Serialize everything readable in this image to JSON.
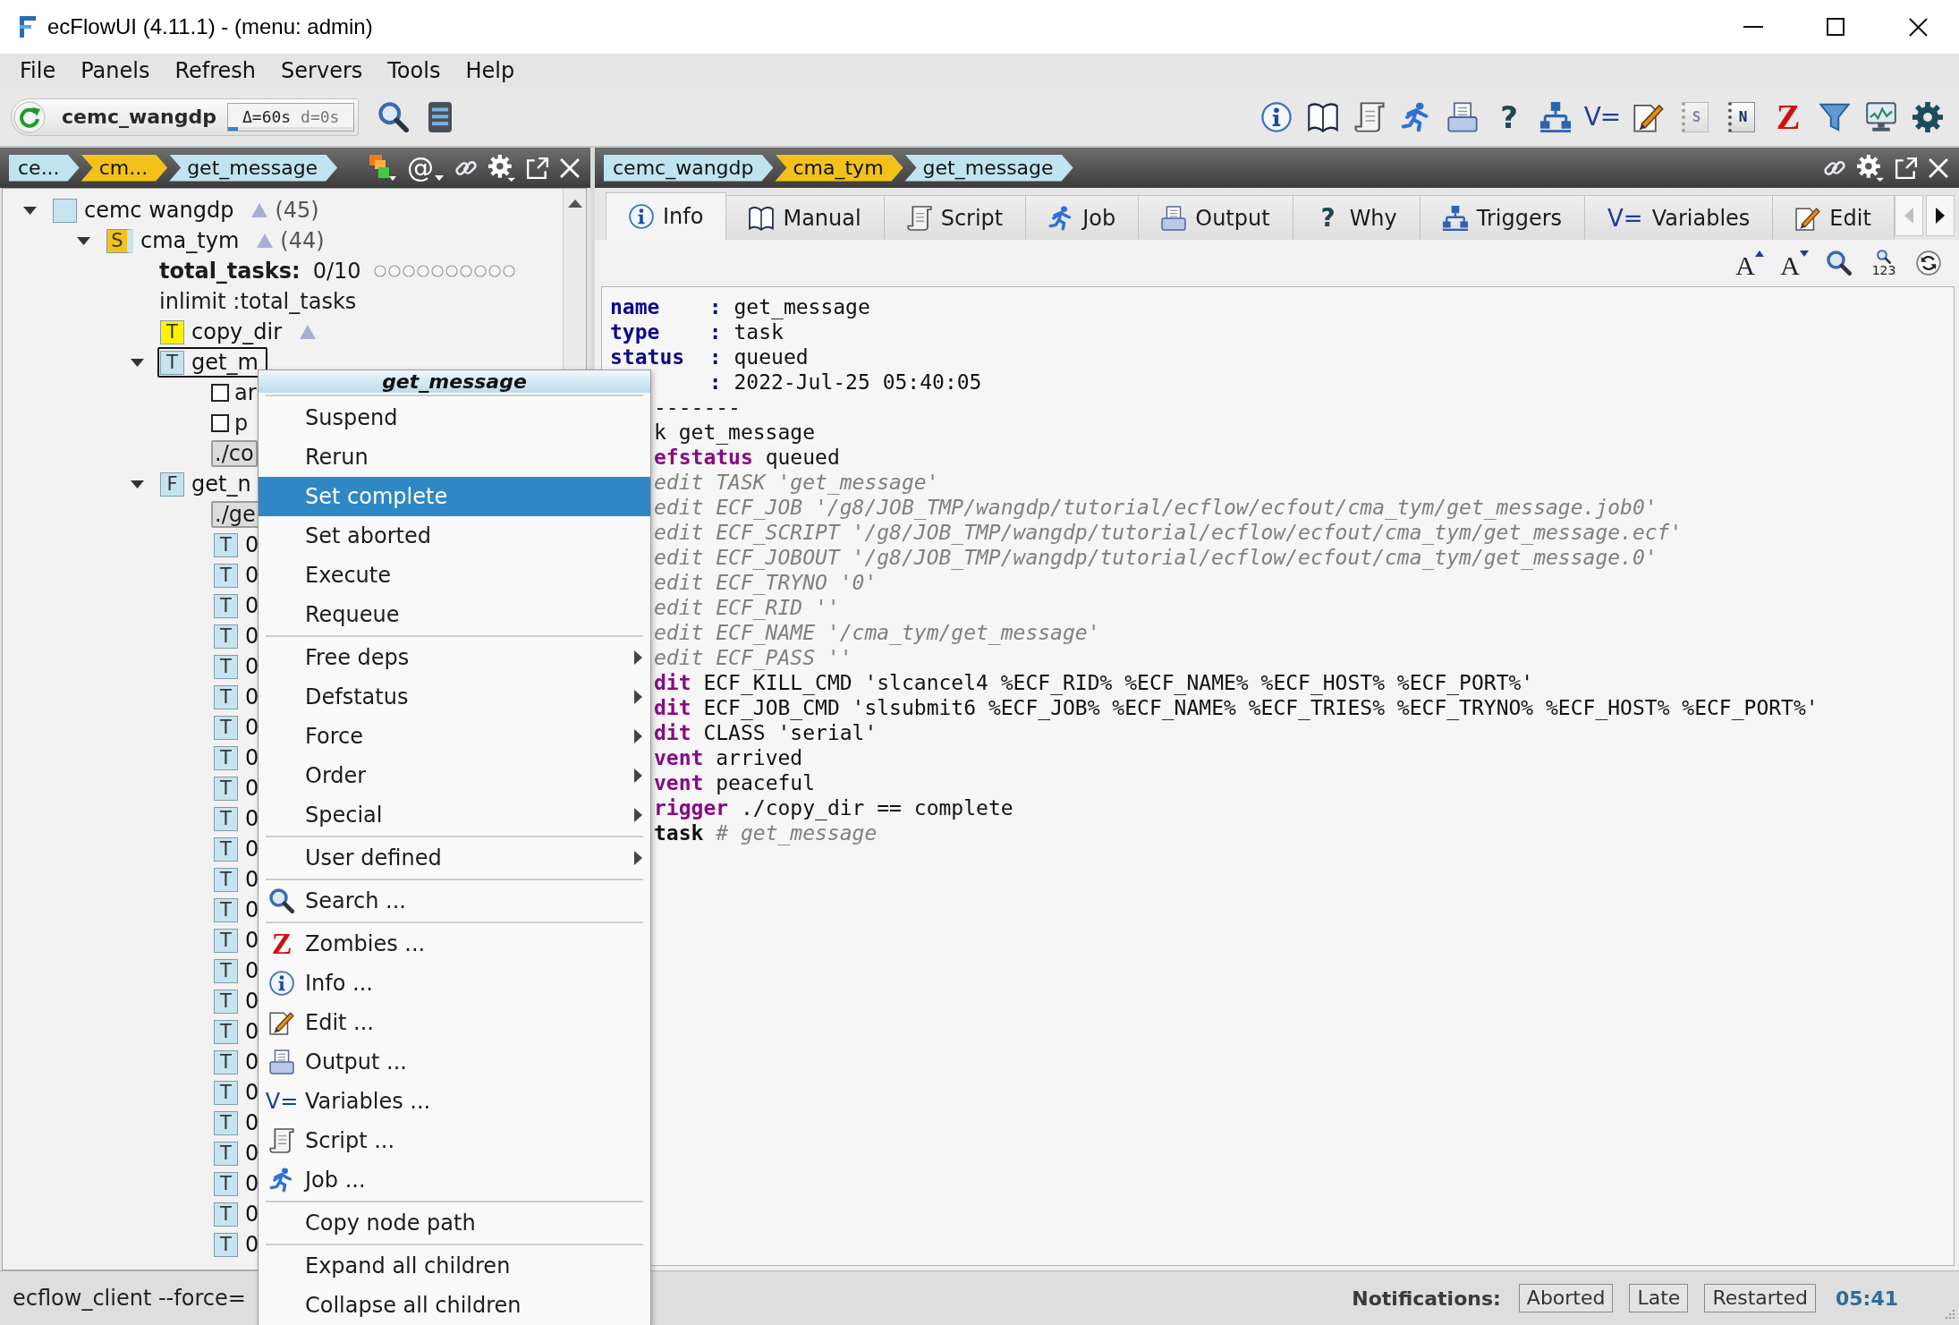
{
  "window": {
    "title": "ecFlowUI (4.11.1) - (menu: admin)",
    "controls": [
      {
        "kind": "minimize"
      },
      {
        "kind": "maximize"
      },
      {
        "kind": "close"
      }
    ]
  },
  "menu_bar": [
    {
      "label": "File"
    },
    {
      "label": "Panels"
    },
    {
      "label": "Refresh"
    },
    {
      "label": "Servers"
    },
    {
      "label": "Tools"
    },
    {
      "label": "Help"
    }
  ],
  "toolbar": {
    "server": {
      "name": "cemc_wangdp",
      "timing": [
        "Δ=60s",
        "d=0s"
      ],
      "level": 0.08
    },
    "tools": [
      {
        "kind": "search"
      },
      {
        "kind": "server"
      }
    ],
    "panel_buttons": [
      {
        "kind": "info",
        "disabled": false
      },
      {
        "kind": "book",
        "disabled": false
      },
      {
        "kind": "script",
        "disabled": false
      },
      {
        "kind": "job",
        "disabled": false
      },
      {
        "kind": "output",
        "disabled": false
      },
      {
        "kind": "why",
        "glyph": "?",
        "disabled": false
      },
      {
        "kind": "triggers",
        "disabled": false
      },
      {
        "kind": "variables",
        "glyph": "V=",
        "disabled": false
      },
      {
        "kind": "edit",
        "disabled": false
      },
      {
        "kind": "doc",
        "glyph": "S",
        "disabled": true
      },
      {
        "kind": "doc",
        "glyph": "N",
        "disabled": false
      },
      {
        "kind": "zombies",
        "glyph": "Z",
        "disabled": false
      },
      {
        "kind": "filter",
        "disabled": false
      },
      {
        "kind": "monitor",
        "disabled": false
      },
      {
        "kind": "gear",
        "disabled": false
      }
    ]
  },
  "left_panel": {
    "breadcrumbs": [
      {
        "label": "ce...",
        "color": "#bfe4f0"
      },
      {
        "label": "cm...",
        "color": "#f2c21b"
      },
      {
        "label": "get_message",
        "color": "#bfe4f0"
      }
    ],
    "header_buttons": [
      {
        "kind": "states"
      },
      {
        "kind": "at",
        "glyph": "@"
      },
      {
        "kind": "link"
      },
      {
        "kind": "gear"
      },
      {
        "kind": "detach"
      },
      {
        "kind": "close"
      }
    ],
    "tree": [
      {
        "kind": "server",
        "label": "cemc wangdp",
        "color": "#c6e4ef",
        "triangle_icon": true,
        "count": "(45)",
        "selected": false,
        "expanded": true,
        "children": [
          {
            "kind": "suite",
            "letter": "S",
            "label": "cma_tym",
            "color": "#f2c21b",
            "strip": {
              "color": "#c6e4ef"
            },
            "triangle_icon": true,
            "count": "(44)",
            "selected": false,
            "expanded": true,
            "children": [
              {
                "kind": "limit",
                "name": "total_tasks:",
                "value": "0/10",
                "selected": false
              },
              {
                "kind": "inlimit",
                "label": "inlimit :total_tasks",
                "selected": false
              },
              {
                "kind": "task",
                "letter": "T",
                "label": "copy_dir",
                "color": "#fff200",
                "triangle_icon": true,
                "selected": false
              },
              {
                "kind": "task",
                "letter": "T",
                "label": "get_m",
                "color": "#c6e4ef",
                "triangle_icon": false,
                "selected": true,
                "expanded": true,
                "children": [
                  {
                    "kind": "event",
                    "label": "ar",
                    "checked": false,
                    "selected": false
                  },
                  {
                    "kind": "event",
                    "label": "p",
                    "checked": false,
                    "selected": false
                  },
                  {
                    "kind": "trigger",
                    "label": "./co",
                    "selected": false
                  }
                ]
              },
              {
                "kind": "family",
                "letter": "F",
                "label": "get_n",
                "color": "#c6e4ef",
                "triangle_icon": false,
                "selected": false,
                "expanded": true,
                "children": [
                  {
                    "kind": "trigger",
                    "label": "./ge",
                    "selected": false
                  },
                  {
                    "kind": "task",
                    "letter": "T",
                    "label": "0",
                    "color": "#c6e4ef",
                    "triangle_icon": false,
                    "selected": false
                  },
                  {
                    "kind": "task",
                    "letter": "T",
                    "label": "0",
                    "color": "#c6e4ef",
                    "triangle_icon": false,
                    "selected": false
                  },
                  {
                    "kind": "task",
                    "letter": "T",
                    "label": "0",
                    "color": "#c6e4ef",
                    "triangle_icon": false,
                    "selected": false
                  },
                  {
                    "kind": "task",
                    "letter": "T",
                    "label": "0",
                    "color": "#c6e4ef",
                    "triangle_icon": false,
                    "selected": false
                  },
                  {
                    "kind": "task",
                    "letter": "T",
                    "label": "0",
                    "color": "#c6e4ef",
                    "triangle_icon": false,
                    "selected": false
                  },
                  {
                    "kind": "task",
                    "letter": "T",
                    "label": "0",
                    "color": "#c6e4ef",
                    "triangle_icon": false,
                    "selected": false
                  },
                  {
                    "kind": "task",
                    "letter": "T",
                    "label": "0",
                    "color": "#c6e4ef",
                    "triangle_icon": false,
                    "selected": false
                  },
                  {
                    "kind": "task",
                    "letter": "T",
                    "label": "0",
                    "color": "#c6e4ef",
                    "triangle_icon": false,
                    "selected": false
                  },
                  {
                    "kind": "task",
                    "letter": "T",
                    "label": "0",
                    "color": "#c6e4ef",
                    "triangle_icon": false,
                    "selected": false
                  },
                  {
                    "kind": "task",
                    "letter": "T",
                    "label": "0",
                    "color": "#c6e4ef",
                    "triangle_icon": false,
                    "selected": false
                  },
                  {
                    "kind": "task",
                    "letter": "T",
                    "label": "0",
                    "color": "#c6e4ef",
                    "triangle_icon": false,
                    "selected": false
                  },
                  {
                    "kind": "task",
                    "letter": "T",
                    "label": "0",
                    "color": "#c6e4ef",
                    "triangle_icon": false,
                    "selected": false
                  },
                  {
                    "kind": "task",
                    "letter": "T",
                    "label": "0",
                    "color": "#c6e4ef",
                    "triangle_icon": false,
                    "selected": false
                  },
                  {
                    "kind": "task",
                    "letter": "T",
                    "label": "0",
                    "color": "#c6e4ef",
                    "triangle_icon": false,
                    "selected": false
                  },
                  {
                    "kind": "task",
                    "letter": "T",
                    "label": "0",
                    "color": "#c6e4ef",
                    "triangle_icon": false,
                    "selected": false
                  },
                  {
                    "kind": "task",
                    "letter": "T",
                    "label": "0",
                    "color": "#c6e4ef",
                    "triangle_icon": false,
                    "selected": false
                  },
                  {
                    "kind": "task",
                    "letter": "T",
                    "label": "0",
                    "color": "#c6e4ef",
                    "triangle_icon": false,
                    "selected": false
                  },
                  {
                    "kind": "task",
                    "letter": "T",
                    "label": "0",
                    "color": "#c6e4ef",
                    "triangle_icon": false,
                    "selected": false
                  },
                  {
                    "kind": "task",
                    "letter": "T",
                    "label": "0",
                    "color": "#c6e4ef",
                    "triangle_icon": false,
                    "selected": false
                  },
                  {
                    "kind": "task",
                    "letter": "T",
                    "label": "0",
                    "color": "#c6e4ef",
                    "triangle_icon": false,
                    "selected": false
                  },
                  {
                    "kind": "task",
                    "letter": "T",
                    "label": "0",
                    "color": "#c6e4ef",
                    "triangle_icon": false,
                    "selected": false
                  },
                  {
                    "kind": "task",
                    "letter": "T",
                    "label": "0",
                    "color": "#c6e4ef",
                    "triangle_icon": false,
                    "selected": false
                  },
                  {
                    "kind": "task",
                    "letter": "T",
                    "label": "0",
                    "color": "#c6e4ef",
                    "triangle_icon": false,
                    "selected": false
                  },
                  {
                    "kind": "task",
                    "letter": "T",
                    "label": "0",
                    "color": "#c6e4ef",
                    "triangle_icon": false,
                    "selected": false
                  }
                ]
              }
            ]
          }
        ]
      }
    ]
  },
  "info_panel": {
    "breadcrumbs": [
      {
        "label": "cemc_wangdp",
        "color": "#bfe4f0"
      },
      {
        "label": "cma_tym",
        "color": "#f2c21b"
      },
      {
        "label": "get_message",
        "color": "#bfe4f0"
      }
    ],
    "header_buttons": [
      {
        "kind": "link"
      },
      {
        "kind": "gear"
      },
      {
        "kind": "detach"
      },
      {
        "kind": "close"
      }
    ],
    "tabs": [
      {
        "label": "Info",
        "kind": "info",
        "selected": true
      },
      {
        "label": "Manual",
        "kind": "book",
        "selected": false
      },
      {
        "label": "Script",
        "kind": "script",
        "selected": false
      },
      {
        "label": "Job",
        "kind": "job",
        "selected": false
      },
      {
        "label": "Output",
        "kind": "output",
        "selected": false
      },
      {
        "label": "Why",
        "kind": "why",
        "glyph": "?",
        "selected": false
      },
      {
        "label": "Triggers",
        "kind": "triggers",
        "selected": false
      },
      {
        "label": "Variables",
        "kind": "variables",
        "glyph": "V=",
        "selected": false
      },
      {
        "label": "Edit",
        "kind": "edit",
        "selected": false
      }
    ],
    "tab_scroll": [
      {
        "kind": "left",
        "disabled": true
      },
      {
        "kind": "right",
        "disabled": false
      }
    ],
    "view_tools": [
      {
        "kind": "font_up",
        "glyph": "A"
      },
      {
        "kind": "font_down",
        "glyph": "A"
      },
      {
        "kind": "search"
      },
      {
        "kind": "goto",
        "glyph": "123"
      },
      {
        "kind": "reload"
      }
    ],
    "text_view": {
      "lines": [
        {
          "kind": "field",
          "key": "name",
          "colon": ":",
          "value": "get_message"
        },
        {
          "kind": "field",
          "key": "type",
          "colon": ":",
          "value": "task"
        },
        {
          "kind": "field",
          "key": "status",
          "colon": ":",
          "value": "queued"
        }
      ],
      "lines_beside_menu": [
        {
          "kind": "field",
          "colon": ":",
          "value": "2022-Jul-25 05:40:05"
        },
        {
          "kind": "code",
          "segments": [
            {
              "kind": "plain",
              "text": "-------"
            }
          ]
        },
        {
          "kind": "code",
          "segments": [
            {
              "kind": "plain",
              "text": "k get_message"
            }
          ]
        },
        {
          "kind": "code",
          "segments": [
            {
              "kind": "keyword",
              "text": "efstatus"
            },
            {
              "kind": "plain",
              "text": "queued"
            }
          ]
        },
        {
          "kind": "code",
          "segments": [
            {
              "kind": "comment",
              "text": "edit TASK 'get_message'"
            }
          ]
        },
        {
          "kind": "code",
          "segments": [
            {
              "kind": "comment",
              "text": "edit ECF_JOB '/g8/JOB_TMP/wangdp/tutorial/ecflow/ecfout/cma_tym/get_message.job0'"
            }
          ]
        },
        {
          "kind": "code",
          "segments": [
            {
              "kind": "comment",
              "text": "edit ECF_SCRIPT '/g8/JOB_TMP/wangdp/tutorial/ecflow/ecfout/cma_tym/get_message.ecf'"
            }
          ]
        },
        {
          "kind": "code",
          "segments": [
            {
              "kind": "comment",
              "text": "edit ECF_JOBOUT '/g8/JOB_TMP/wangdp/tutorial/ecflow/ecfout/cma_tym/get_message.0'"
            }
          ]
        },
        {
          "kind": "code",
          "segments": [
            {
              "kind": "comment",
              "text": "edit ECF_TRYNO '0'"
            }
          ]
        },
        {
          "kind": "code",
          "segments": [
            {
              "kind": "comment",
              "text": "edit ECF_RID ''"
            }
          ]
        },
        {
          "kind": "code",
          "segments": [
            {
              "kind": "comment",
              "text": "edit ECF_NAME '/cma_tym/get_message'"
            }
          ]
        },
        {
          "kind": "code",
          "segments": [
            {
              "kind": "comment",
              "text": "edit ECF_PASS ''"
            }
          ]
        },
        {
          "kind": "code",
          "segments": [
            {
              "kind": "keyword",
              "text": "dit"
            },
            {
              "kind": "plain",
              "text": "ECF_KILL_CMD 'slcancel4 %ECF_RID% %ECF_NAME% %ECF_HOST% %ECF_PORT%'"
            }
          ]
        },
        {
          "kind": "code",
          "segments": [
            {
              "kind": "keyword",
              "text": "dit"
            },
            {
              "kind": "plain",
              "text": "ECF_JOB_CMD 'slsubmit6 %ECF_JOB% %ECF_NAME% %ECF_TRIES% %ECF_TRYNO% %ECF_HOST% %ECF_PORT%'"
            }
          ]
        },
        {
          "kind": "code",
          "segments": [
            {
              "kind": "keyword",
              "text": "dit"
            },
            {
              "kind": "plain",
              "text": "CLASS 'serial'"
            }
          ]
        },
        {
          "kind": "code",
          "segments": [
            {
              "kind": "keyword",
              "text": "vent"
            },
            {
              "kind": "plain",
              "text": "arrived"
            }
          ]
        },
        {
          "kind": "code",
          "segments": [
            {
              "kind": "keyword",
              "text": "vent"
            },
            {
              "kind": "plain",
              "text": "peaceful"
            }
          ]
        },
        {
          "kind": "code",
          "segments": [
            {
              "kind": "keyword",
              "text": "rigger"
            },
            {
              "kind": "plain",
              "text": "./copy_dir == complete"
            }
          ]
        },
        {
          "kind": "code",
          "segments": [
            {
              "kind": "end",
              "text": "task"
            },
            {
              "kind": "comment",
              "text": "# get_message"
            }
          ]
        }
      ]
    }
  },
  "context_menu": {
    "title": "get_message",
    "groups": [
      [
        {
          "label": "Suspend",
          "kind": "plain",
          "selected": false,
          "submenu": false
        },
        {
          "label": "Rerun",
          "kind": "plain",
          "selected": false,
          "submenu": false
        },
        {
          "label": "Set complete",
          "kind": "plain",
          "selected": true,
          "submenu": false
        },
        {
          "label": "Set aborted",
          "kind": "plain",
          "selected": false,
          "submenu": false
        },
        {
          "label": "Execute",
          "kind": "plain",
          "selected": false,
          "submenu": false
        },
        {
          "label": "Requeue",
          "kind": "plain",
          "selected": false,
          "submenu": false
        }
      ],
      [
        {
          "label": "Free deps",
          "kind": "plain",
          "selected": false,
          "submenu": true
        },
        {
          "label": "Defstatus",
          "kind": "plain",
          "selected": false,
          "submenu": true
        },
        {
          "label": "Force",
          "kind": "plain",
          "selected": false,
          "submenu": true
        },
        {
          "label": "Order",
          "kind": "plain",
          "selected": false,
          "submenu": true
        },
        {
          "label": "Special",
          "kind": "plain",
          "selected": false,
          "submenu": true
        }
      ],
      [
        {
          "label": "User defined",
          "kind": "plain",
          "selected": false,
          "submenu": true
        }
      ],
      [
        {
          "label": "Search ...",
          "kind": "search",
          "selected": false,
          "submenu": false
        }
      ],
      [
        {
          "label": "Zombies ...",
          "kind": "zombies",
          "glyph": "Z",
          "selected": false,
          "submenu": false
        },
        {
          "label": "Info ...",
          "kind": "info",
          "selected": false,
          "submenu": false
        },
        {
          "label": "Edit ...",
          "kind": "edit",
          "selected": false,
          "submenu": false
        },
        {
          "label": "Output ...",
          "kind": "output",
          "selected": false,
          "submenu": false
        },
        {
          "label": "Variables ...",
          "kind": "variables",
          "glyph": "V=",
          "selected": false,
          "submenu": false
        },
        {
          "label": "Script ...",
          "kind": "script",
          "selected": false,
          "submenu": false
        },
        {
          "label": "Job ...",
          "kind": "job",
          "selected": false,
          "submenu": false
        }
      ],
      [
        {
          "label": "Copy node path",
          "kind": "plain",
          "selected": false,
          "submenu": false
        }
      ],
      [
        {
          "label": "Expand all children",
          "kind": "plain",
          "selected": false,
          "submenu": false
        },
        {
          "label": "Collapse all children",
          "kind": "plain",
          "selected": false,
          "submenu": false
        }
      ]
    ]
  },
  "status_bar": {
    "command": "ecflow_client --force=",
    "notifications_label": "Notifications:",
    "notifications": [
      {
        "label": "Aborted"
      },
      {
        "label": "Late"
      },
      {
        "label": "Restarted"
      }
    ],
    "time": "05:41"
  }
}
